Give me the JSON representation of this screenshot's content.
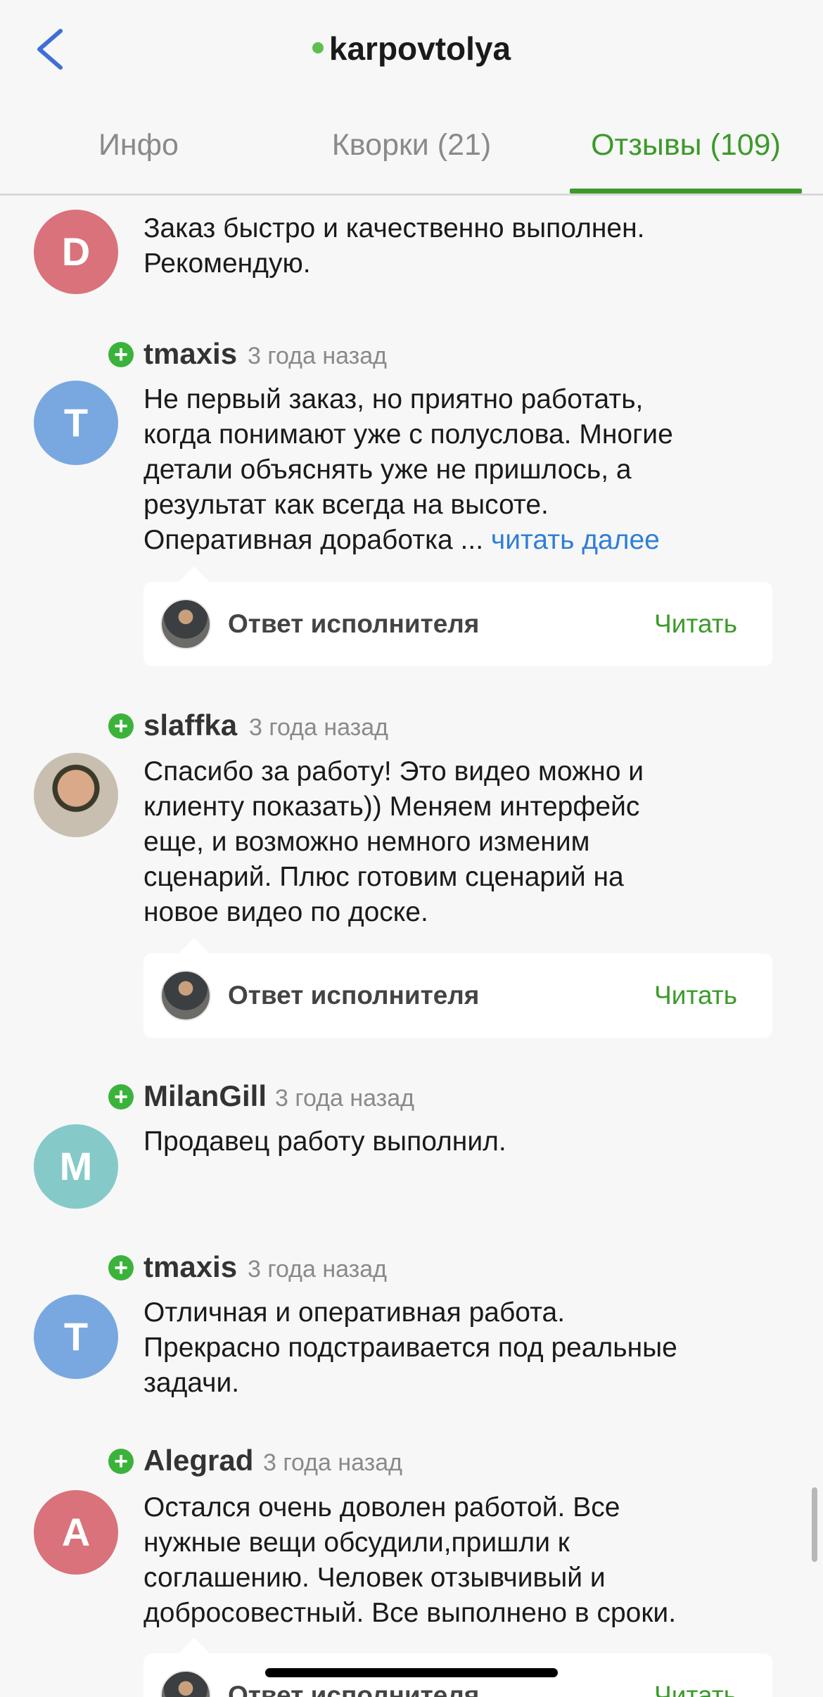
{
  "header": {
    "title": "karpovtolya",
    "status_color": "#5fbf4c"
  },
  "tabs": [
    {
      "label": "Инфо",
      "active": false
    },
    {
      "label": "Кворки (21)",
      "active": false
    },
    {
      "label": "Отзывы (109)",
      "active": true
    }
  ],
  "colors": {
    "accent": "#3c9a2a",
    "link": "#2f7fd6"
  },
  "reviews": [
    {
      "avatar_letter": "D",
      "avatar_color": "#d9727a",
      "text": "Заказ быстро и качественно выполнен.\nРекомендую."
    },
    {
      "username": "tmaxis",
      "time": "3 года назад",
      "avatar_letter": "T",
      "avatar_color": "#79a8e0",
      "text": "Не первый заказ, но приятно работать,\nкогда понимают уже с полуслова. Многие\nдетали объяснять уже не пришлось, а\nрезультат как всегда на высоте.\nОперативная доработка ... ",
      "more_label": "читать далее",
      "answer_label": "Ответ исполнителя",
      "read_label": "Читать"
    },
    {
      "username": "slaffka",
      "time": "3 года назад",
      "avatar_letter": "",
      "text": "Спасибо за работу! Это видео можно и\nклиенту показать)) Меняем интерфейс\nеще, и возможно немного изменим\nсценарий. Плюс готовим сценарий на\nновое видео по доске.",
      "answer_label": "Ответ исполнителя",
      "read_label": "Читать"
    },
    {
      "username": "MilanGill",
      "time": "3 года назад",
      "avatar_letter": "M",
      "avatar_color": "#86c9c9",
      "text": "Продавец работу выполнил."
    },
    {
      "username": "tmaxis",
      "time": "3 года назад",
      "avatar_letter": "T",
      "avatar_color": "#79a8e0",
      "text": "Отличная и оперативная работа.\nПрекрасно подстраивается под реальные\nзадачи."
    },
    {
      "username": "Alegrad",
      "time": "3 года назад",
      "avatar_letter": "A",
      "avatar_color": "#d9727a",
      "text": "Остался очень доволен работой. Все\nнужные вещи обсудили,пришли к\nсоглашению. Человек отзывчивый и\nдобросовестный. Все выполнено в сроки.",
      "answer_label": "Ответ исполнителя",
      "read_label": "Читать"
    }
  ]
}
